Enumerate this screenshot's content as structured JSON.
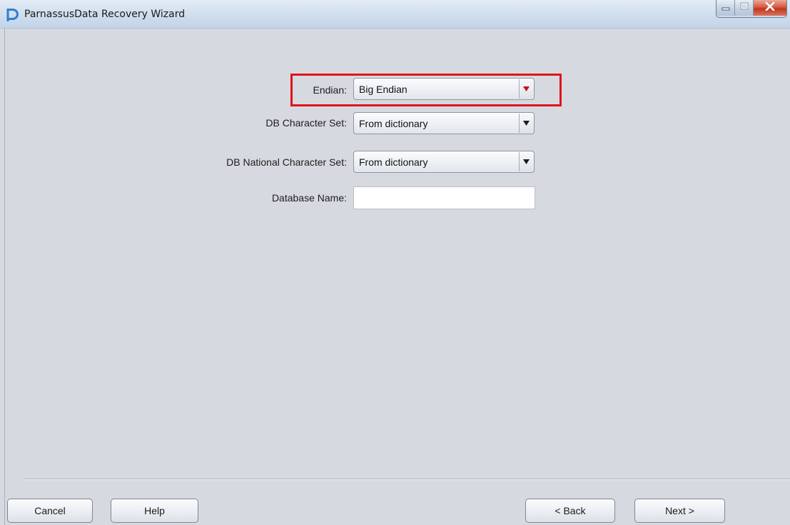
{
  "window": {
    "title": "ParnassusData Recovery Wizard",
    "icon": "parnassus-logo-icon",
    "controls": [
      "minimize-icon",
      "maximize-icon",
      "close-icon"
    ]
  },
  "form": {
    "endian": {
      "label": "Endian:",
      "value": "Big Endian"
    },
    "db_charset": {
      "label": "DB Character Set:",
      "value": "From dictionary"
    },
    "db_national_charset": {
      "label": "DB National Character Set:",
      "value": "From dictionary"
    },
    "database_name": {
      "label": "Database Name:",
      "value": ""
    }
  },
  "buttons": {
    "cancel": "Cancel",
    "help": "Help",
    "back": "< Back",
    "next": "Next >"
  },
  "colors": {
    "highlight": "#e0141d",
    "background": "#d6d9df",
    "logo": "#2f7fd0"
  }
}
